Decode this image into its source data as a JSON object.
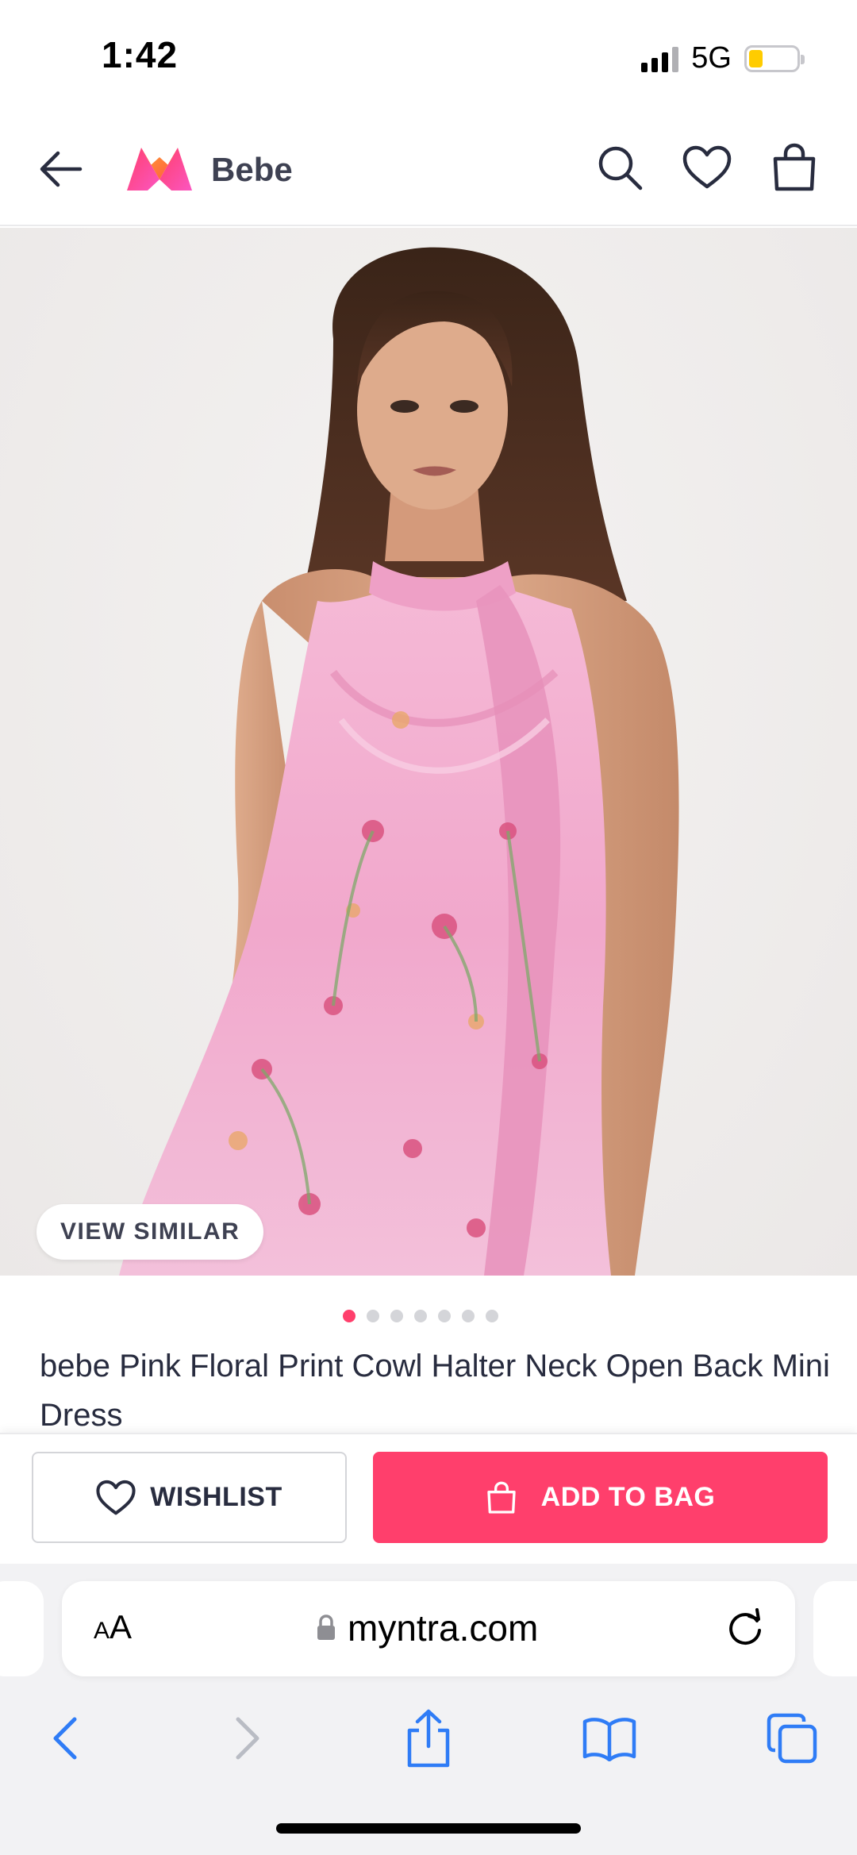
{
  "status_bar": {
    "time": "1:42",
    "network": "5G",
    "battery_level": 0.3
  },
  "header": {
    "brand": "Bebe",
    "icons": [
      "back-arrow-icon",
      "myntra-logo",
      "search-icon",
      "heart-icon",
      "bag-icon"
    ]
  },
  "product": {
    "view_similar_label": "VIEW SIMILAR",
    "image_count": 7,
    "active_image_index": 0,
    "title": "bebe Pink Floral Print Cowl Halter Neck Open Back Mini Dress"
  },
  "actions": {
    "wishlist_label": "WISHLIST",
    "add_to_bag_label": "ADD TO BAG"
  },
  "browser": {
    "text_size_label_small": "A",
    "text_size_label_large": "A",
    "url": "myntra.com"
  },
  "colors": {
    "accent": "#ff3f6c",
    "text": "#282c3f",
    "ios_blue": "#2f7cf6"
  }
}
